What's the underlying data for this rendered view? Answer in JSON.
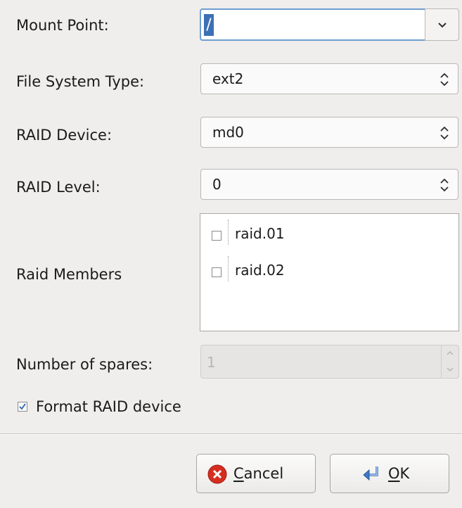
{
  "form": {
    "mount_point": {
      "label": "Mount Point:",
      "value": "/"
    },
    "fs_type": {
      "label": "File System Type:",
      "value": "ext2"
    },
    "raid_device": {
      "label": "RAID Device:",
      "value": "md0"
    },
    "raid_level": {
      "label": "RAID Level:",
      "value": "0"
    },
    "raid_members": {
      "label": "Raid Members",
      "items": [
        {
          "label": "raid.01",
          "checked": false
        },
        {
          "label": "raid.02",
          "checked": false
        }
      ]
    },
    "spares": {
      "label": "Number of spares:",
      "value": "1",
      "disabled": true
    },
    "format": {
      "label": "Format RAID device",
      "checked": true
    }
  },
  "buttons": {
    "cancel_mnemonic": "C",
    "cancel_rest": "ancel",
    "ok_mnemonic": "O",
    "ok_rest": "K"
  },
  "icons": {
    "cancel": "cancel-icon",
    "ok": "ok-icon",
    "dropdown": "chevron-down-icon",
    "spinner": "up-down-arrows-icon"
  },
  "colors": {
    "focus_border": "#6f9ed1",
    "selection": "#3c70b4",
    "cancel_red": "#d62d20",
    "ok_blue": "#3f77c4"
  }
}
